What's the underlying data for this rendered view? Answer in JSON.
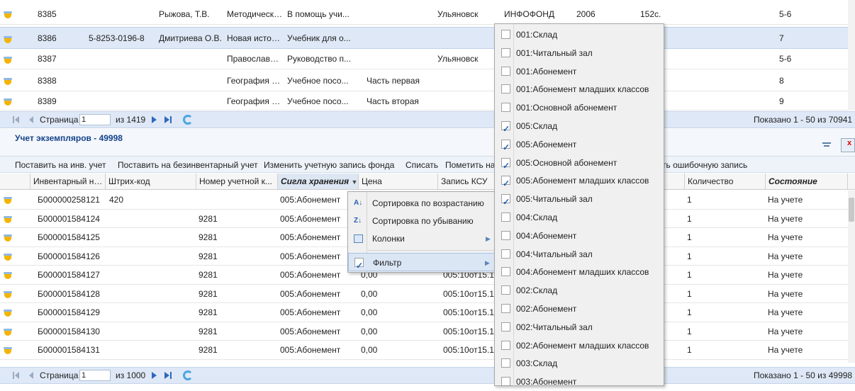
{
  "top_grid": {
    "rows": [
      {
        "c1": "8385",
        "c2": "",
        "c3": "Рыжова, Т.В.",
        "c4": "Методические...",
        "c5": "В помощь учи...",
        "c6": "",
        "c7": "Ульяновск",
        "c8": "ИНФОФОНД",
        "c9": "2006",
        "c10": "152с.",
        "c11": "5-6"
      },
      {
        "c1": "8386",
        "c2": "5-8253-0196-8",
        "c3": "Дмитриева О.В.",
        "c4": "Новая истори...",
        "c5": "Учебник для о...",
        "c6": "",
        "c7": "",
        "c8": "",
        "c9": "",
        "c10": "",
        "c11": "7"
      },
      {
        "c1": "8387",
        "c2": "",
        "c3": "",
        "c4": "Православна...",
        "c5": "Руководство п...",
        "c6": "",
        "c7": "Ульяновск",
        "c8": "",
        "c9": "",
        "c10": "",
        "c11": "5-6"
      },
      {
        "c1": "8388",
        "c2": "",
        "c3": "",
        "c4": "География Бе...",
        "c5": "Учебное посо...",
        "c6": "Часть первая",
        "c7": "",
        "c8": "",
        "c9": "",
        "c10": "",
        "c11": "8"
      },
      {
        "c1": "8389",
        "c2": "",
        "c3": "",
        "c4": "География Бе...",
        "c5": "Учебное посо...",
        "c6": "Часть вторая",
        "c7": "",
        "c8": "",
        "c9": "",
        "c10": "",
        "c11": "9"
      }
    ],
    "pager": {
      "page_label": "Страница",
      "page_value": "1",
      "of_total": "из 1419",
      "shown": "Показано 1 - 50 из 70941"
    }
  },
  "bottom_panel": {
    "title": "Учет экземпляров - 49998",
    "toolbar": {
      "t1": "Поставить на инв. учет",
      "t2": "Поставить на безинвентарный учет",
      "t3": "Изменить учетную запись фонда",
      "t4": "Списать",
      "t5": "Пометить на",
      "t6": "ть ошибочную запись"
    },
    "columns": {
      "inv": "Инвентарный но...",
      "barcode": "Штрих-код",
      "account": "Номер учетной к...",
      "sigla": "Сигла хранения",
      "price": "Цена",
      "ksu": "Запись КСУ",
      "qty": "Количество",
      "state": "Состояние"
    },
    "rows": [
      {
        "inv": "Б000000258121",
        "barcode": "420",
        "account": "",
        "sigla": "005:Абонемент",
        "price": "",
        "ksu": "",
        "qty": "1",
        "state": "На учете"
      },
      {
        "inv": "Б000001584124",
        "barcode": "",
        "account": "9281",
        "sigla": "005:Абонемент",
        "price": "",
        "ksu": "",
        "qty": "1",
        "state": "На учете"
      },
      {
        "inv": "Б000001584125",
        "barcode": "",
        "account": "9281",
        "sigla": "005:Абонемент",
        "price": "",
        "ksu": "",
        "qty": "1",
        "state": "На учете"
      },
      {
        "inv": "Б000001584126",
        "barcode": "",
        "account": "9281",
        "sigla": "005:Абонемент",
        "price": "",
        "ksu": "",
        "qty": "1",
        "state": "На учете"
      },
      {
        "inv": "Б000001584127",
        "barcode": "",
        "account": "9281",
        "sigla": "005:Абонемент",
        "price": "0,00",
        "ksu": "005:10от15.1",
        "qty": "1",
        "state": "На учете"
      },
      {
        "inv": "Б000001584128",
        "barcode": "",
        "account": "9281",
        "sigla": "005:Абонемент",
        "price": "0,00",
        "ksu": "005:10от15.1",
        "qty": "1",
        "state": "На учете"
      },
      {
        "inv": "Б000001584129",
        "barcode": "",
        "account": "9281",
        "sigla": "005:Абонемент",
        "price": "0,00",
        "ksu": "005:10от15.1",
        "qty": "1",
        "state": "На учете"
      },
      {
        "inv": "Б000001584130",
        "barcode": "",
        "account": "9281",
        "sigla": "005:Абонемент",
        "price": "0,00",
        "ksu": "005:10от15.1",
        "qty": "1",
        "state": "На учете"
      },
      {
        "inv": "Б000001584131",
        "barcode": "",
        "account": "9281",
        "sigla": "005:Абонемент",
        "price": "0,00",
        "ksu": "005:10от15.1",
        "qty": "1",
        "state": "На учете"
      }
    ],
    "pager": {
      "page_label": "Страница",
      "page_value": "1",
      "of_total": "из 1000",
      "shown": "Показано 1 - 50 из 49998"
    }
  },
  "column_menu": {
    "sort_asc": "Сортировка по возрастанию",
    "sort_desc": "Сортировка по убыванию",
    "columns": "Колонки",
    "filter": "Фильтр"
  },
  "filter_list": [
    {
      "label": "001:Склад",
      "checked": false
    },
    {
      "label": "001:Читальный зал",
      "checked": false
    },
    {
      "label": "001:Абонемент",
      "checked": false
    },
    {
      "label": "001:Абонемент младших классов",
      "checked": false
    },
    {
      "label": "001:Основной абонемент",
      "checked": false
    },
    {
      "label": "005:Склад",
      "checked": true
    },
    {
      "label": "005:Абонемент",
      "checked": true
    },
    {
      "label": "005:Основной абонемент",
      "checked": true
    },
    {
      "label": "005:Абонемент младших классов",
      "checked": true
    },
    {
      "label": "005:Читальный зал",
      "checked": true
    },
    {
      "label": "004:Склад",
      "checked": false
    },
    {
      "label": "004:Абонемент",
      "checked": false
    },
    {
      "label": "004:Читальный зал",
      "checked": false
    },
    {
      "label": "004:Абонемент младших классов",
      "checked": false
    },
    {
      "label": "002:Склад",
      "checked": false
    },
    {
      "label": "002:Абонемент",
      "checked": false
    },
    {
      "label": "002:Читальный зал",
      "checked": false
    },
    {
      "label": "002:Абонемент младших классов",
      "checked": false
    },
    {
      "label": "003:Склад",
      "checked": false
    },
    {
      "label": "003:Абонемент",
      "checked": false
    }
  ],
  "colors": {
    "selection": "#dfe8f6",
    "pager": "#dfe8f6",
    "title": "#15428b",
    "menu_bg": "#f0f0f0"
  }
}
